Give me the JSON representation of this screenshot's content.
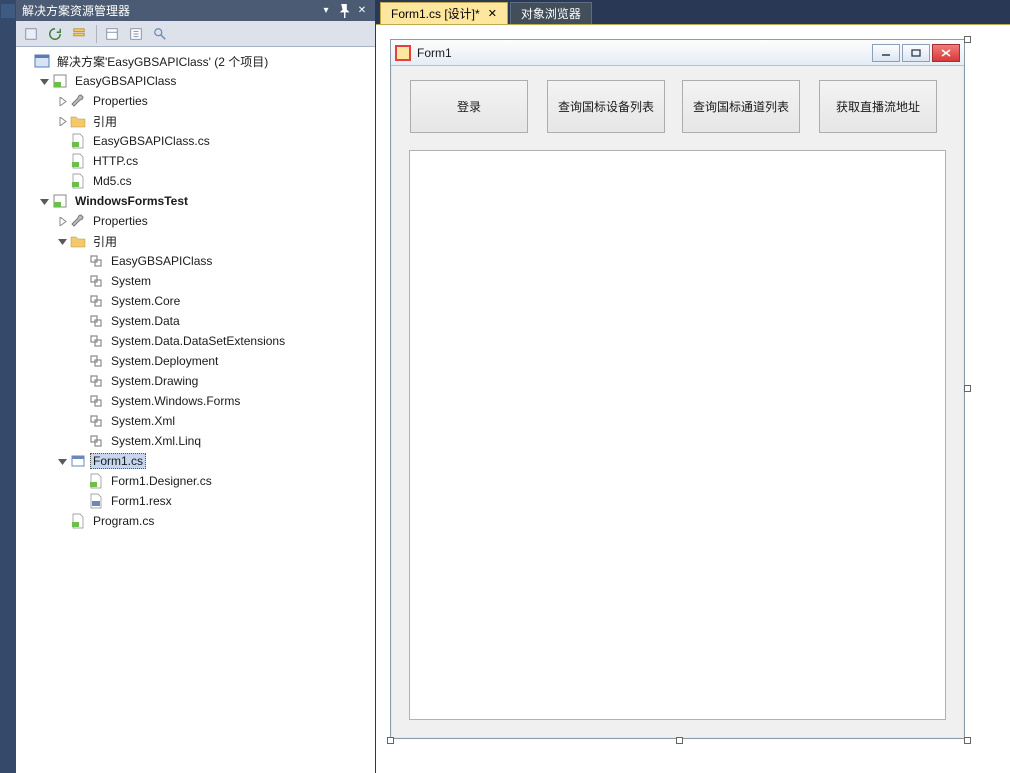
{
  "solution_panel": {
    "title": "解决方案资源管理器",
    "solution_label": "解决方案'EasyGBSAPIClass' (2 个项目)"
  },
  "tree": {
    "easyApi": "EasyGBSAPIClass",
    "easyApi_props": "Properties",
    "easyApi_refs": "引用",
    "easyApi_class_cs": "EasyGBSAPIClass.cs",
    "easyApi_http_cs": "HTTP.cs",
    "easyApi_md5_cs": "Md5.cs",
    "wft": "WindowsFormsTest",
    "wft_props": "Properties",
    "wft_refs": "引用",
    "ref_easy": "EasyGBSAPIClass",
    "ref_system": "System",
    "ref_core": "System.Core",
    "ref_data": "System.Data",
    "ref_dse": "System.Data.DataSetExtensions",
    "ref_deploy": "System.Deployment",
    "ref_draw": "System.Drawing",
    "ref_winforms": "System.Windows.Forms",
    "ref_xml": "System.Xml",
    "ref_xmllinq": "System.Xml.Linq",
    "wft_form1": "Form1.cs",
    "wft_form1_designer": "Form1.Designer.cs",
    "wft_form1_resx": "Form1.resx",
    "wft_program": "Program.cs"
  },
  "tabs": {
    "active": "Form1.cs [设计]*",
    "inactive": "对象浏览器"
  },
  "form": {
    "title": "Form1",
    "btn1": "登录",
    "btn2": "查询国标设备列表",
    "btn3": "查询国标通道列表",
    "btn4": "获取直播流地址"
  }
}
